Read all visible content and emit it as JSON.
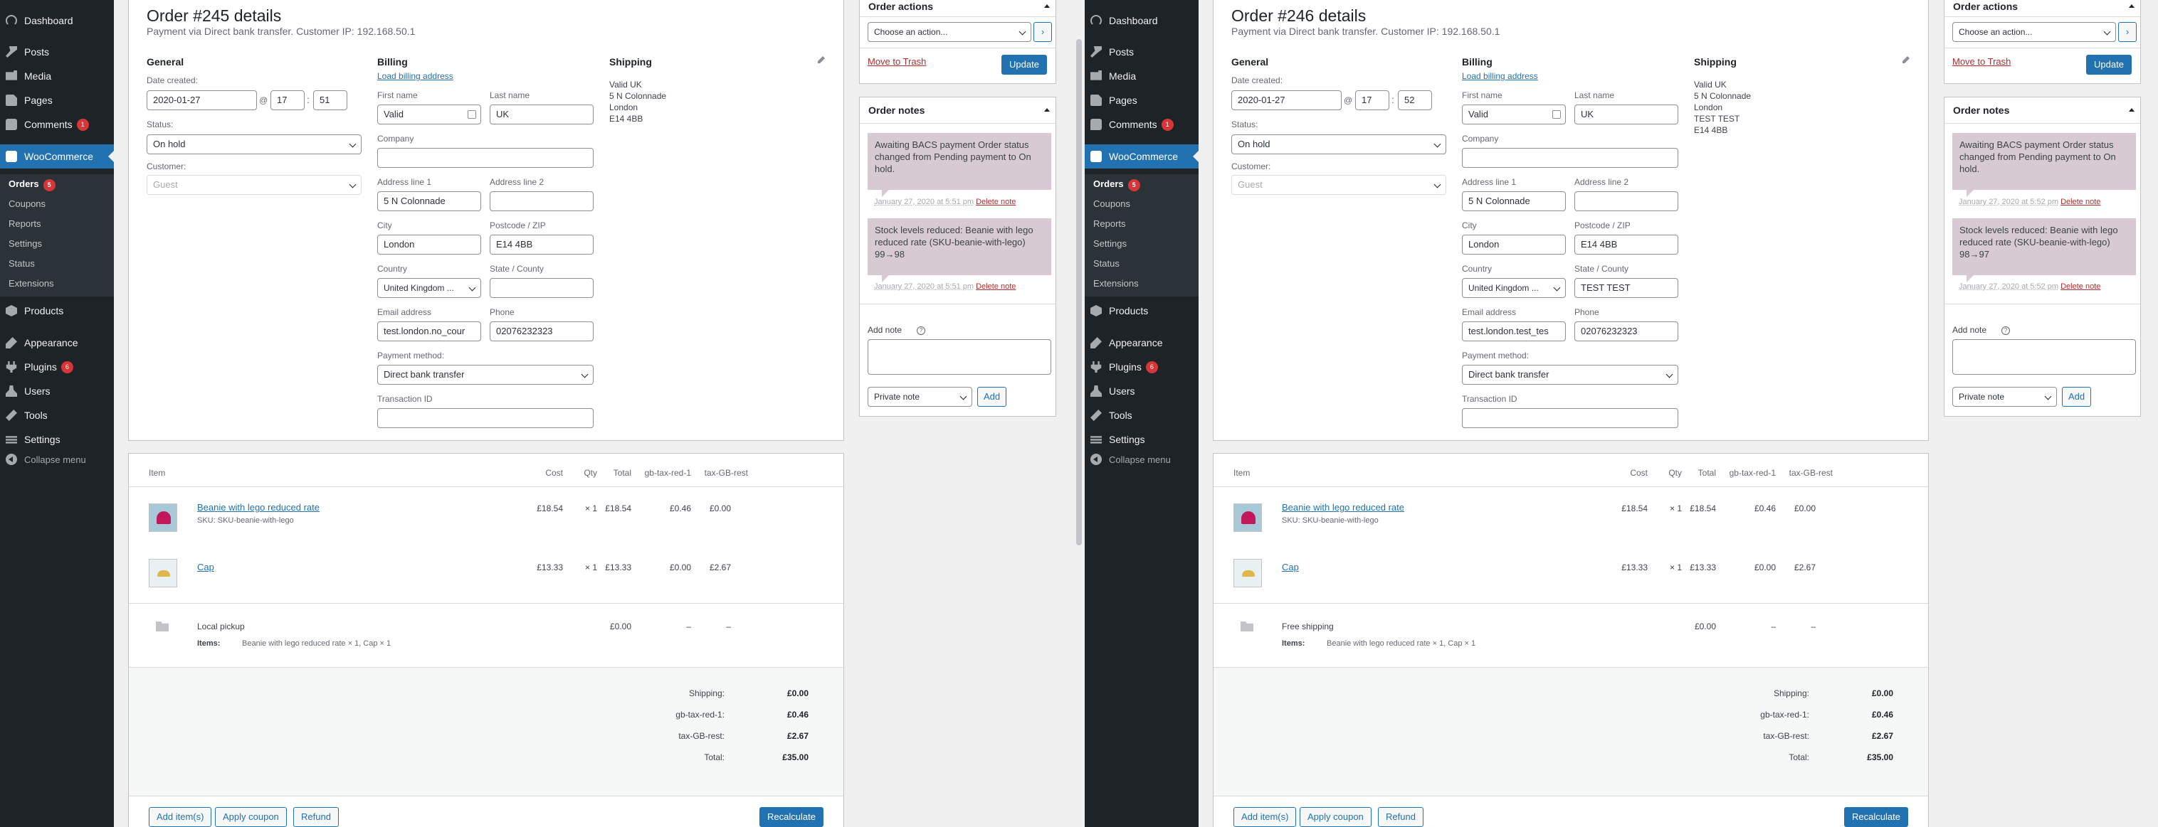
{
  "menu": {
    "dashboard": "Dashboard",
    "posts": "Posts",
    "media": "Media",
    "pages": "Pages",
    "comments": "Comments",
    "comments_badge": "1",
    "woocommerce": "WooCommerce",
    "orders": "Orders",
    "orders_badge": "5",
    "coupons": "Coupons",
    "reports": "Reports",
    "settings_sub": "Settings",
    "status": "Status",
    "extensions": "Extensions",
    "products": "Products",
    "appearance": "Appearance",
    "plugins": "Plugins",
    "plugins_badge": "6",
    "users": "Users",
    "tools": "Tools",
    "settings": "Settings",
    "collapse": "Collapse menu"
  },
  "labels": {
    "general": "General",
    "date_created": "Date created:",
    "at": "@",
    "colon": ":",
    "status": "Status:",
    "customer": "Customer:",
    "billing": "Billing",
    "load_billing": "Load billing address",
    "shipping": "Shipping",
    "first_name": "First name",
    "last_name": "Last name",
    "company": "Company",
    "address_1": "Address line 1",
    "address_2": "Address line 2",
    "city": "City",
    "postcode": "Postcode / ZIP",
    "country": "Country",
    "state": "State / County",
    "email": "Email address",
    "phone": "Phone",
    "payment_method": "Payment method:",
    "transaction_id": "Transaction ID",
    "col_item": "Item",
    "col_cost": "Cost",
    "col_qty": "Qty",
    "col_total": "Total",
    "col_tax1": "gb-tax-red-1",
    "col_tax2": "tax-GB-rest",
    "items_label": "Items:",
    "tot_shipping": "Shipping:",
    "tot_tax1": "gb-tax-red-1:",
    "tot_tax2": "tax-GB-rest:",
    "tot_total": "Total:",
    "add_items": "Add item(s)",
    "apply_coupon": "Apply coupon",
    "refund": "Refund",
    "recalculate": "Recalculate",
    "order_actions": "Order actions",
    "choose_action": "Choose an action...",
    "go": "›",
    "move_trash": "Move to Trash",
    "update": "Update",
    "order_notes": "Order notes",
    "add_note": "Add note",
    "help": "?",
    "private_note": "Private note",
    "add": "Add",
    "delete_note": "Delete note"
  },
  "orders": [
    {
      "title": "Order #245 details",
      "subtitle": "Payment via Direct bank transfer. Customer IP: 192.168.50.1",
      "date": "2020-01-27",
      "hour": "17",
      "minute": "51",
      "status": "On hold",
      "customer": "Guest",
      "first_name": "Valid",
      "last_name": "UK",
      "company": "",
      "address_1": "5 N Colonnade",
      "address_2": "",
      "city": "London",
      "postcode": "E14 4BB",
      "country": "United Kingdom ...",
      "state": "",
      "email": "test.london.no_cour",
      "phone": "02076232323",
      "payment_method": "Direct bank transfer",
      "transaction_id": "",
      "shipping_address": "Valid UK\n5 N Colonnade\nLondon\nE14 4BB",
      "items": [
        {
          "name": "Beanie with lego reduced rate",
          "sku": "SKU: SKU-beanie-with-lego",
          "cost": "£18.54",
          "qty": "× 1",
          "total": "£18.54",
          "tax1": "£0.46",
          "tax2": "£0.00"
        },
        {
          "name": "Cap",
          "sku": "",
          "cost": "£13.33",
          "qty": "× 1",
          "total": "£13.33",
          "tax1": "£0.00",
          "tax2": "£2.67"
        }
      ],
      "shipping_line": {
        "name": "Local pickup",
        "items": "Beanie with lego reduced rate × 1, Cap × 1",
        "total": "£0.00",
        "tax1": "–",
        "tax2": "–"
      },
      "totals": {
        "shipping": "£0.00",
        "tax1": "£0.46",
        "tax2": "£2.67",
        "total": "£35.00"
      },
      "notes": [
        {
          "text": "Awaiting BACS payment Order status changed from Pending payment to On hold.",
          "date": "January 27, 2020 at 5:51 pm"
        },
        {
          "text": "Stock levels reduced: Beanie with lego reduced rate (SKU-beanie-with-lego) 99→98",
          "date": "January 27, 2020 at 5:51 pm"
        }
      ]
    },
    {
      "title": "Order #246 details",
      "subtitle": "Payment via Direct bank transfer. Customer IP: 192.168.50.1",
      "date": "2020-01-27",
      "hour": "17",
      "minute": "52",
      "status": "On hold",
      "customer": "Guest",
      "first_name": "Valid",
      "last_name": "UK",
      "company": "",
      "address_1": "5 N Colonnade",
      "address_2": "",
      "city": "London",
      "postcode": "E14 4BB",
      "country": "United Kingdom ...",
      "state": "TEST TEST",
      "email": "test.london.test_tes",
      "phone": "02076232323",
      "payment_method": "Direct bank transfer",
      "transaction_id": "",
      "shipping_address": "Valid UK\n5 N Colonnade\nLondon\nTEST TEST\nE14 4BB",
      "items": [
        {
          "name": "Beanie with lego reduced rate",
          "sku": "SKU: SKU-beanie-with-lego",
          "cost": "£18.54",
          "qty": "× 1",
          "total": "£18.54",
          "tax1": "£0.46",
          "tax2": "£0.00"
        },
        {
          "name": "Cap",
          "sku": "",
          "cost": "£13.33",
          "qty": "× 1",
          "total": "£13.33",
          "tax1": "£0.00",
          "tax2": "£2.67"
        }
      ],
      "shipping_line": {
        "name": "Free shipping",
        "items": "Beanie with lego reduced rate × 1, Cap × 1",
        "total": "£0.00",
        "tax1": "–",
        "tax2": "–"
      },
      "totals": {
        "shipping": "£0.00",
        "tax1": "£0.46",
        "tax2": "£2.67",
        "total": "£35.00"
      },
      "notes": [
        {
          "text": "Awaiting BACS payment Order status changed from Pending payment to On hold.",
          "date": "January 27, 2020 at 5:52 pm"
        },
        {
          "text": "Stock levels reduced: Beanie with lego reduced rate (SKU-beanie-with-lego) 98→97",
          "date": "January 27, 2020 at 5:52 pm"
        }
      ]
    }
  ]
}
